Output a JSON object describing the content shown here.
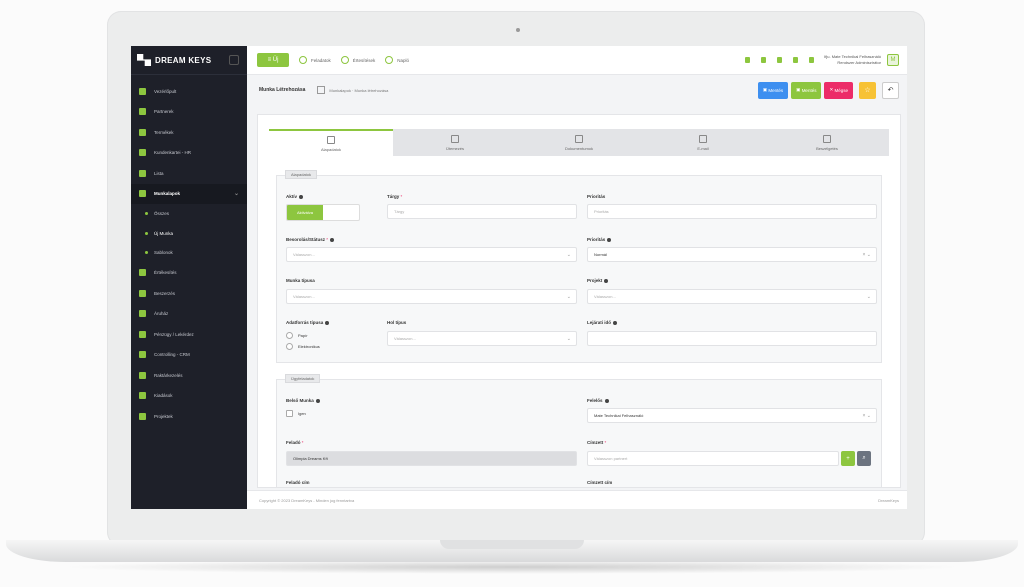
{
  "app": {
    "brand": "DREAM KEYS",
    "accent": "#8dc63f"
  },
  "sidebar": {
    "items": [
      {
        "label": "Vezérlőpult",
        "icon": "dashboard-icon"
      },
      {
        "label": "Partnerek",
        "icon": "partners-icon"
      },
      {
        "label": "Termékek",
        "icon": "products-icon"
      },
      {
        "label": "Kundenkartei - HR",
        "icon": "hr-icon"
      },
      {
        "label": "Lista",
        "icon": "list-icon"
      },
      {
        "label": "Munkalapok",
        "icon": "worksheet-icon",
        "active": true
      },
      {
        "label": "Összes",
        "icon": "dot-icon",
        "sub": true
      },
      {
        "label": "Új Munka",
        "icon": "dot-icon",
        "sub": true,
        "current": true
      },
      {
        "label": "Sablonok",
        "icon": "dot-icon",
        "sub": true
      },
      {
        "label": "Értékesítés",
        "icon": "sales-icon"
      },
      {
        "label": "Beszerzés",
        "icon": "purchase-icon"
      },
      {
        "label": "Áruház",
        "icon": "store-icon"
      },
      {
        "label": "Pénzügy / Lekérdez",
        "icon": "finance-icon"
      },
      {
        "label": "Controlling - CRM",
        "icon": "controlling-icon"
      },
      {
        "label": "Raktárkezelés",
        "icon": "warehouse-icon"
      },
      {
        "label": "Kiadások",
        "icon": "expenses-icon"
      },
      {
        "label": "Projektek",
        "icon": "projects-icon"
      }
    ]
  },
  "topbar": {
    "menu_label": "≡ Új",
    "quick_links": [
      "Feladatok",
      "Értesítések",
      "Napló"
    ],
    "user_name": "Ifju. Mate Technikai Felhasználó",
    "user_role": "Rendszer Adminisztrátor",
    "avatar": "M"
  },
  "subheader": {
    "title": "Munka Létrehozása",
    "breadcrumb": "Munkalapok · Munka létrehozása",
    "buttons": {
      "save": "Mentés",
      "save_close": "Mentés",
      "cancel": "Mégse"
    }
  },
  "tabs": [
    "Alapadatok",
    "Ütemezés",
    "Dokumentumok",
    "E-mail",
    "Beszélgetés"
  ],
  "panel1": {
    "title": "Alapadatok",
    "aktiv_label": "Aktív",
    "aktiv_value": "Aktiválva",
    "targy_label": "Tárgy",
    "targy_placeholder": "Tárgy",
    "prioritas_label": "Prioritás",
    "prioritas_placeholder": "Prioritás",
    "besorolas_label": "Besorolás/Státusz",
    "select_placeholder": "Válasszon...",
    "prioritas2_label": "Prioritás",
    "prioritas2_value": "Normál",
    "munka_tipus_label": "Munka típusa",
    "projekt_label": "Projekt",
    "adatforras_label": "Adatforrás típusa",
    "radio_1": "Papír",
    "radio_2": "Elektronikus",
    "hol_label": "Hol típus",
    "hol_placeholder": "Válasszon...",
    "lejarat_label": "Lejárati idő"
  },
  "panel2": {
    "title": "Ügyfeladatok",
    "belso_label": "Belső Munka",
    "belso_value": "Igen",
    "felelos_label": "Felelős",
    "felelos_value": "Mate Technikai Felhasználó",
    "felado_label": "Feladó",
    "felado_value": "Olimpia Dreams Kft",
    "cimzett_label": "Címzett",
    "cimzett_placeholder": "Válasszon partnert",
    "more_left": "Feladó cím",
    "more_right": "Címzett cím"
  },
  "footer": {
    "copyright": "Copyright © 2023 DreamKeys - Minden jog fenntartva",
    "right": "DreamKeys"
  }
}
